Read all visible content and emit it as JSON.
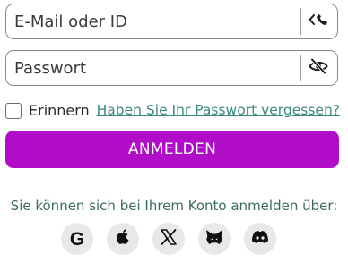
{
  "login": {
    "email_placeholder": "E-Mail oder ID",
    "password_placeholder": "Passwort",
    "remember_label": "Erinnern",
    "forgot_link": "Haben Sie Ihr Passwort vergessen?",
    "submit_label": "ANMELDEN",
    "social_text": "Sie können sich bei Ihrem Konto anmelden über:",
    "email_suffix_icon": "toggle-phone-login-icon",
    "password_suffix_icon": "eye-off-icon"
  },
  "social": {
    "google_letter": "G",
    "providers": [
      "google-icon",
      "apple-icon",
      "x-icon",
      "metamask-icon",
      "discord-icon"
    ]
  },
  "colors": {
    "accent": "#b10dc9",
    "link": "#3a8a7c",
    "border": "#8a8a8a",
    "social_bg": "#e8e8e8"
  }
}
